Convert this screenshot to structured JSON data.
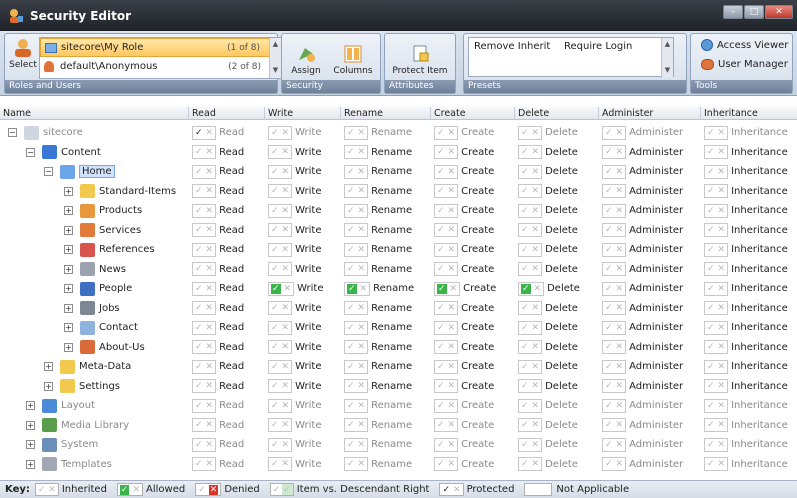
{
  "window": {
    "title": "Security Editor"
  },
  "ribbon": {
    "select_label": "Select",
    "roles": [
      {
        "name": "sitecore\\My Role",
        "count": "(1 of 8)",
        "selected": true
      },
      {
        "name": "default\\Anonymous",
        "count": "(2 of 8)",
        "selected": false
      }
    ],
    "roles_group": "Roles and Users",
    "assign_label": "Assign",
    "columns_label": "Columns",
    "security_group": "Security",
    "protect_label": "Protect Item",
    "attributes_group": "Attributes",
    "preset_remove": "Remove Inherit",
    "preset_require": "Require Login",
    "presets_group": "Presets",
    "access_viewer": "Access Viewer",
    "user_manager": "User Manager",
    "tools_group": "Tools"
  },
  "columns": [
    "Name",
    "Read",
    "Write",
    "Rename",
    "Create",
    "Delete",
    "Administer",
    "Inheritance"
  ],
  "rights": [
    "Read",
    "Write",
    "Rename",
    "Create",
    "Delete",
    "Administer",
    "Inheritance"
  ],
  "rows": [
    {
      "name": "sitecore",
      "level": 0,
      "exp": "−",
      "gray": true,
      "icon": "#cfd6e0",
      "allowed": [],
      "protected_read": true
    },
    {
      "name": "Content",
      "level": 1,
      "exp": "−",
      "gray": false,
      "icon": "#3b78d6",
      "allowed": []
    },
    {
      "name": "Home",
      "level": 2,
      "exp": "−",
      "gray": false,
      "icon": "#6aa6e8",
      "allowed": [],
      "highlight": true
    },
    {
      "name": "Standard-Items",
      "level": 3,
      "exp": "+",
      "gray": false,
      "icon": "#f2c94c",
      "allowed": []
    },
    {
      "name": "Products",
      "level": 3,
      "exp": "+",
      "gray": false,
      "icon": "#e8973a",
      "allowed": []
    },
    {
      "name": "Services",
      "level": 3,
      "exp": "+",
      "gray": false,
      "icon": "#e07b39",
      "allowed": []
    },
    {
      "name": "References",
      "level": 3,
      "exp": "+",
      "gray": false,
      "icon": "#d9534f",
      "allowed": []
    },
    {
      "name": "News",
      "level": 3,
      "exp": "+",
      "gray": false,
      "icon": "#9aa3ad",
      "allowed": []
    },
    {
      "name": "People",
      "level": 3,
      "exp": "+",
      "gray": false,
      "icon": "#3f6fc2",
      "allowed": [
        "Write",
        "Rename",
        "Create",
        "Delete"
      ]
    },
    {
      "name": "Jobs",
      "level": 3,
      "exp": "+",
      "gray": false,
      "icon": "#7d8794",
      "allowed": []
    },
    {
      "name": "Contact",
      "level": 3,
      "exp": "+",
      "gray": false,
      "icon": "#8fb3dc",
      "allowed": []
    },
    {
      "name": "About-Us",
      "level": 3,
      "exp": "+",
      "gray": false,
      "icon": "#d96a3a",
      "allowed": []
    },
    {
      "name": "Meta-Data",
      "level": 2,
      "exp": "+",
      "gray": false,
      "icon": "#f2c94c",
      "allowed": []
    },
    {
      "name": "Settings",
      "level": 2,
      "exp": "+",
      "gray": false,
      "icon": "#f2c94c",
      "allowed": []
    },
    {
      "name": "Layout",
      "level": 1,
      "exp": "+",
      "gray": true,
      "icon": "#4a8ad6",
      "allowed": []
    },
    {
      "name": "Media Library",
      "level": 1,
      "exp": "+",
      "gray": true,
      "icon": "#5a9e4b",
      "allowed": []
    },
    {
      "name": "System",
      "level": 1,
      "exp": "+",
      "gray": true,
      "icon": "#6b8fb8",
      "allowed": []
    },
    {
      "name": "Templates",
      "level": 1,
      "exp": "+",
      "gray": true,
      "icon": "#a0a8b3",
      "allowed": []
    }
  ],
  "key": {
    "label": "Key:",
    "inherited": "Inherited",
    "allowed": "Allowed",
    "denied": "Denied",
    "descendant": "Item vs. Descendant Right",
    "protected": "Protected",
    "na": "Not Applicable"
  }
}
